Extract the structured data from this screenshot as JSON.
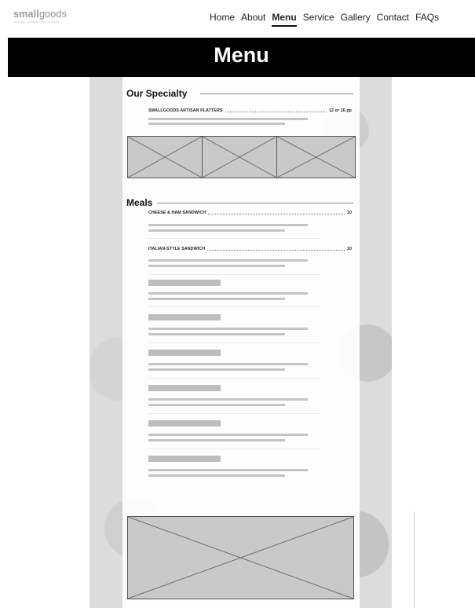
{
  "brand": {
    "name_bold": "small",
    "name_rest": "goods",
    "tagline": "CATERING CATERED & DELICATESSEN"
  },
  "nav": {
    "items": [
      "Home",
      "About",
      "Menu",
      "Service",
      "Gallery",
      "Contact",
      "FAQs"
    ],
    "active": "Menu"
  },
  "banner": {
    "title": "Menu"
  },
  "specialty": {
    "heading": "Our Specialty",
    "item": {
      "name": "SMALLGOODS ARTISAN PLATTERS",
      "price": "12 or 16 pp"
    }
  },
  "meals": {
    "heading": "Meals",
    "items": [
      {
        "name": "CHEESE & HAM SANDWICH",
        "price": "10"
      },
      {
        "name": "ITALIAN-STYLE SANDWICH",
        "price": "10"
      }
    ]
  }
}
